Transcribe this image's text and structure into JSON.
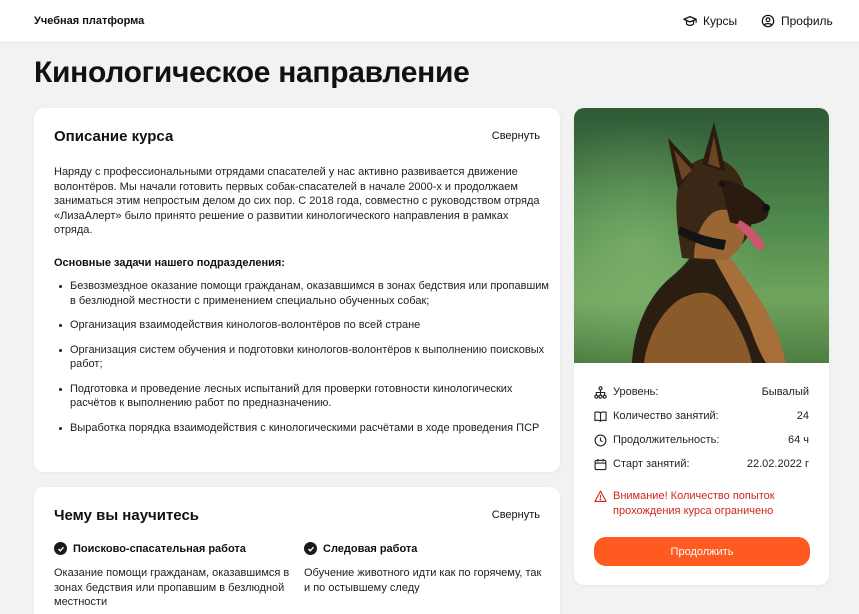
{
  "header": {
    "logo": "Учебная платформа",
    "nav": [
      {
        "label": "Курсы",
        "icon": "graduation-cap-icon"
      },
      {
        "label": "Профиль",
        "icon": "user-circle-icon"
      }
    ]
  },
  "page": {
    "title": "Кинологическое направление"
  },
  "description": {
    "title": "Описание курса",
    "collapse_label": "Свернуть",
    "text": "Наряду с профессиональными отрядами спасателей у нас активно развивается движение волонтёров. Мы начали готовить первых собак-спасателей в начале 2000-х и продолжаем заниматься этим непростым делом до сих пор. С 2018 года, совместно с руководством отряда «ЛизаАлерт» было принято решение о развитии кинологического направления в рамках отряда.",
    "tasks_title": "Основные задачи нашего подразделения:",
    "tasks": [
      "Безвозмездное оказание помощи гражданам, оказавшимся в зонах бедствия или пропавшим в безлюдной местности с применением специально обученных собак;",
      "Организация взаимодействия кинологов-волонтёров по всей стране",
      "Организация систем обучения и подготовки кинологов-волонтёров к выполнению поисковых работ;",
      "Подготовка и проведение лесных испытаний для проверки готовности кинологических расчётов к выполнению работ по предназначению.",
      "Выработка порядка взаимодействия с кинологическими расчётами в ходе проведения ПСР"
    ]
  },
  "learn": {
    "title": "Чему вы научитесь",
    "collapse_label": "Свернуть",
    "skills": [
      {
        "title": "Поисково-спасательная работа",
        "text": "Оказание помощи гражданам, оказавшимся в зонах бедствия или пропавшим в безлюдной местности"
      },
      {
        "title": "Следовая работа",
        "text": "Обучение животного идти как по горячему, так и по остывшему следу"
      }
    ]
  },
  "sidebar": {
    "image_subject": "german-shepherd-dog-photo",
    "info": [
      {
        "icon": "hierarchy-icon",
        "label": "Уровень:",
        "value": "Бывалый"
      },
      {
        "icon": "book-icon",
        "label": "Количество занятий:",
        "value": "24"
      },
      {
        "icon": "clock-icon",
        "label": "Продолжительность:",
        "value": "64 ч"
      },
      {
        "icon": "calendar-icon",
        "label": "Старт занятий:",
        "value": "22.02.2022 г"
      }
    ],
    "warning": "Внимание! Количество попыток прохождения курса ограничено",
    "continue_label": "Продолжить"
  },
  "colors": {
    "accent": "#ff5a1f",
    "warning": "#d0261f",
    "background": "#f2f2f2",
    "card": "#ffffff"
  }
}
